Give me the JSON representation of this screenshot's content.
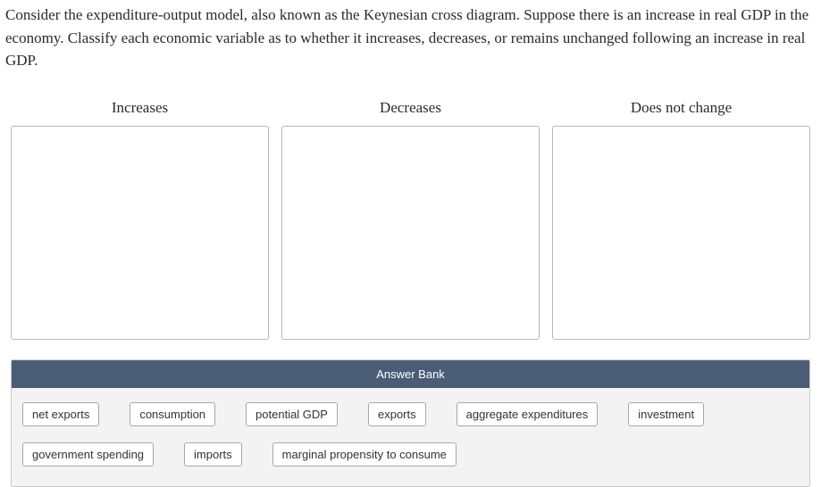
{
  "question": "Consider the expenditure-output model, also known as the Keynesian cross diagram. Suppose there is an increase in real GDP in the economy. Classify each economic variable as to whether it increases, decreases, or remains unchanged following an increase in real GDP.",
  "columns": {
    "increases": "Increases",
    "decreases": "Decreases",
    "no_change": "Does not change"
  },
  "answer_bank": {
    "header": "Answer Bank",
    "row1": {
      "t0": "net exports",
      "t1": "consumption",
      "t2": "potential GDP",
      "t3": "exports",
      "t4": "aggregate expenditures",
      "t5": "investment"
    },
    "row2": {
      "t0": "government spending",
      "t1": "imports",
      "t2": "marginal propensity to consume"
    }
  }
}
